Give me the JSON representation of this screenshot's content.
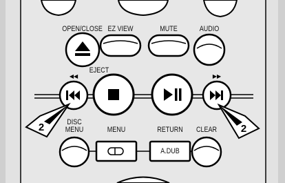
{
  "labels": {
    "open_close": "OPEN/CLOSE",
    "ez_view": "EZ VIEW",
    "mute": "MUTE",
    "audio": "AUDIO",
    "eject": "EJECT",
    "disc_menu_1": "DISC",
    "disc_menu_2": "MENU",
    "menu": "MENU",
    "return": "RETURN",
    "clear": "CLEAR",
    "a_dub": "A.DUB"
  },
  "glyphs": {
    "rewind_hint": "◀◀",
    "forward_hint": "▶▶"
  },
  "callouts": {
    "left": "2",
    "right": "2"
  },
  "colors": {
    "panel": "#e7e7e7",
    "frame": "#c9c9c9",
    "line": "#000000"
  }
}
